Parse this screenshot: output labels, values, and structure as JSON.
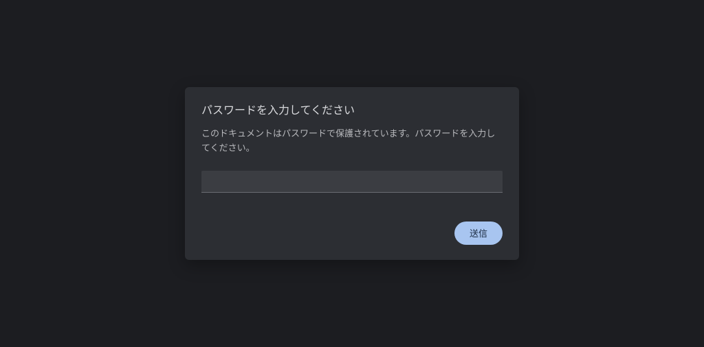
{
  "dialog": {
    "title": "パスワードを入力してください",
    "description": "このドキュメントはパスワードで保護されています。パスワードを入力してください。",
    "password_value": "",
    "submit_label": "送信"
  }
}
